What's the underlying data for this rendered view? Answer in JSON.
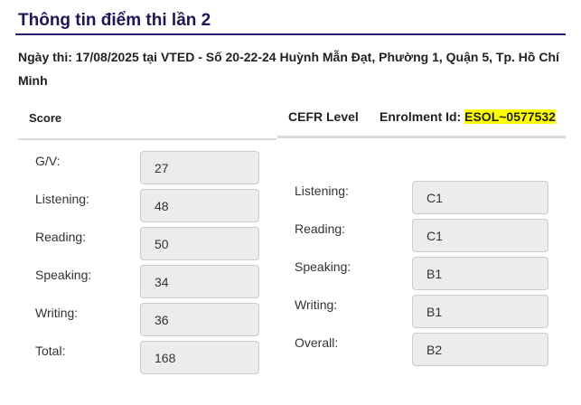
{
  "title": "Thông tin điểm thi lần 2",
  "exam_info": "Ngày thi: 17/08/2025 tại VTED - Số 20-22-24 Huỳnh Mẫn Đạt, Phường 1, Quận 5, Tp. Hồ Chí Minh",
  "score_section": {
    "header": "Score",
    "rows": [
      {
        "label": "G/V:",
        "value": "27"
      },
      {
        "label": "Listening:",
        "value": "48"
      },
      {
        "label": "Reading:",
        "value": "50"
      },
      {
        "label": "Speaking:",
        "value": "34"
      },
      {
        "label": "Writing:",
        "value": "36"
      },
      {
        "label": "Total:",
        "value": "168"
      }
    ]
  },
  "cefr_section": {
    "header": "CEFR Level",
    "enrolment_label": "Enrolment Id:",
    "enrolment_id": "ESOL~0577532",
    "highlight_color": "#ffff00",
    "rows": [
      {
        "label": "Listening:",
        "value": "C1"
      },
      {
        "label": "Reading:",
        "value": "C1"
      },
      {
        "label": "Speaking:",
        "value": "B1"
      },
      {
        "label": "Writing:",
        "value": "B1"
      },
      {
        "label": "Overall:",
        "value": "B2"
      }
    ]
  }
}
